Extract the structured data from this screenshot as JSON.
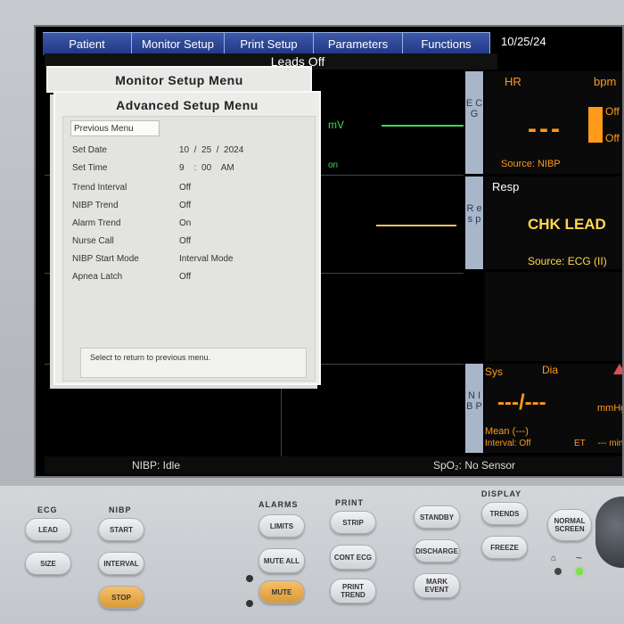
{
  "tabs": [
    "Patient",
    "Monitor Setup",
    "Print Setup",
    "Parameters",
    "Functions"
  ],
  "date": "10/25/24",
  "leads_banner": "Leads Off",
  "ecg_tab": "E C G",
  "resp_tab": "R e s p",
  "nibp_tab": "N I B P",
  "waves": {
    "mv": "mV",
    "on": "on"
  },
  "hr": {
    "label": "HR",
    "unit": "bpm",
    "value": "---",
    "off1": "Off",
    "off2": "Off",
    "source": "Source: NIBP"
  },
  "resp": {
    "label": "Resp",
    "value": "CHK LEAD",
    "source": "Source: ECG (II)"
  },
  "nibp": {
    "sys": "Sys",
    "dia": "Dia",
    "value": "---/---",
    "unit": "mmHg",
    "mean": "Mean (---)",
    "interval": "Interval: Off",
    "et": "ET     --- min"
  },
  "menu_back_title": "Monitor Setup Menu",
  "menu": {
    "title": "Advanced Setup Menu",
    "previous": "Previous Menu",
    "rows": [
      {
        "label": "Set Date",
        "value": "10  /  25  /  2024"
      },
      {
        "label": "Set Time",
        "value": "9    :  00    AM"
      },
      {
        "label": "Trend Interval",
        "value": "Off"
      },
      {
        "label": "NIBP Trend",
        "value": "Off"
      },
      {
        "label": "Alarm Trend",
        "value": "On"
      },
      {
        "label": "Nurse Call",
        "value": "Off"
      },
      {
        "label": "NIBP Start Mode",
        "value": "Interval Mode"
      },
      {
        "label": "Apnea Latch",
        "value": "Off"
      }
    ],
    "help": "Select to return to previous menu."
  },
  "status": {
    "nibp": "NIBP: Idle",
    "spo2": "SpO₂: No Sensor"
  },
  "keypad": {
    "groups": {
      "ecg": "ECG",
      "nibp": "NIBP",
      "alarms": "ALARMS",
      "print": "PRINT",
      "display": "DISPLAY"
    },
    "keys": {
      "lead": "LEAD",
      "size": "SIZE",
      "start": "START",
      "interval": "INTERVAL",
      "stop": "STOP",
      "limits": "LIMITS",
      "mute_all": "MUTE ALL",
      "mute": "MUTE",
      "strip": "STRIP",
      "cont_ecg": "CONT ECG",
      "print_trend": "PRINT TREND",
      "standby": "STANDBY",
      "discharge": "DISCHARGE",
      "mark_event": "MARK EVENT",
      "trends": "TRENDS",
      "freeze": "FREEZE",
      "normal_screen": "NORMAL SCREEN"
    }
  }
}
